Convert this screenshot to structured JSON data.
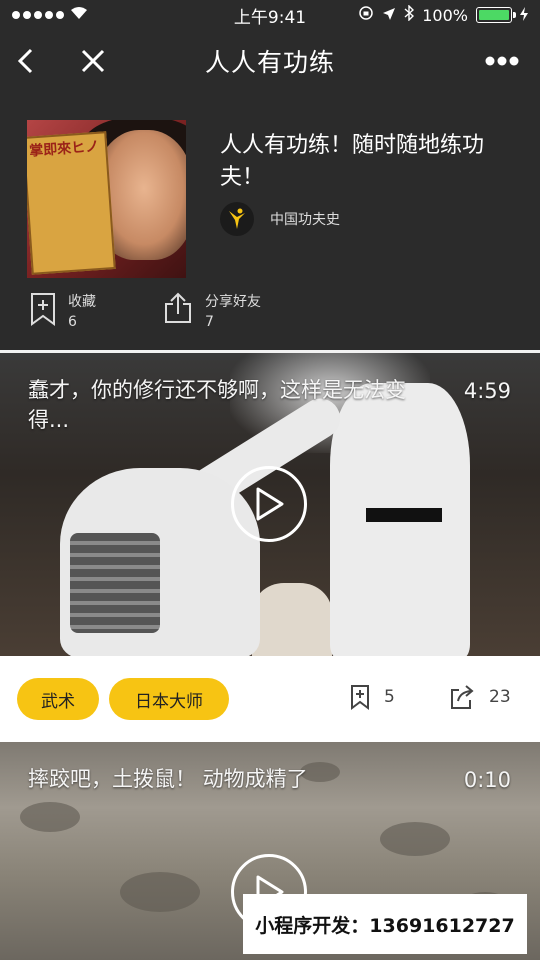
{
  "status_bar": {
    "time": "上午9:41",
    "battery_text": "100%"
  },
  "nav": {
    "title": "人人有功练"
  },
  "header": {
    "cover_text": "掌即來ヒノ",
    "title": "人人有功练！随时随地练功夫！",
    "author": "中国功夫史",
    "favorite_label": "收藏",
    "favorite_count": "6",
    "share_label": "分享好友",
    "share_count": "7"
  },
  "videos": [
    {
      "title": "蠢才，你的修行还不够啊，这样是无法变得...",
      "duration": "4:59",
      "tags": [
        "武术",
        "日本大师"
      ],
      "favorite_count": "5",
      "share_count": "23"
    },
    {
      "title": "摔跤吧，土拨鼠！ 动物成精了",
      "duration": "0:10"
    }
  ],
  "promo": {
    "text": "小程序开发：13691612727"
  },
  "colors": {
    "accent": "#f7c413",
    "background": "#2b2b2b",
    "battery": "#4cd964"
  }
}
